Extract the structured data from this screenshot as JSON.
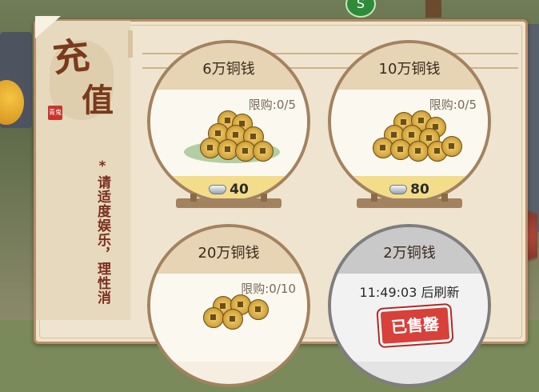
{
  "panel": {
    "title_char1": "充",
    "title_char2": "值",
    "seal_text": "青鬼",
    "notice": "*请适度娱乐，理性消"
  },
  "hud": {
    "top_badge": "S"
  },
  "items": [
    {
      "name": "6万铜钱",
      "limit": "限购:0/5",
      "price": "40"
    },
    {
      "name": "10万铜钱",
      "limit": "限购:0/5",
      "price": "80"
    },
    {
      "name": "20万铜钱",
      "limit": "限购:0/10"
    },
    {
      "name": "2万铜钱",
      "refresh": "11:49:03 后刷新",
      "status": "已售罄"
    }
  ],
  "icons": {
    "currency": "silver-ingot-icon",
    "product": "copper-coins-icon"
  },
  "colors": {
    "panel_bg": "#efe4cf",
    "frame": "#a3825f",
    "price_bar": "#f3dc8a",
    "sold_stamp": "#d8403a"
  }
}
